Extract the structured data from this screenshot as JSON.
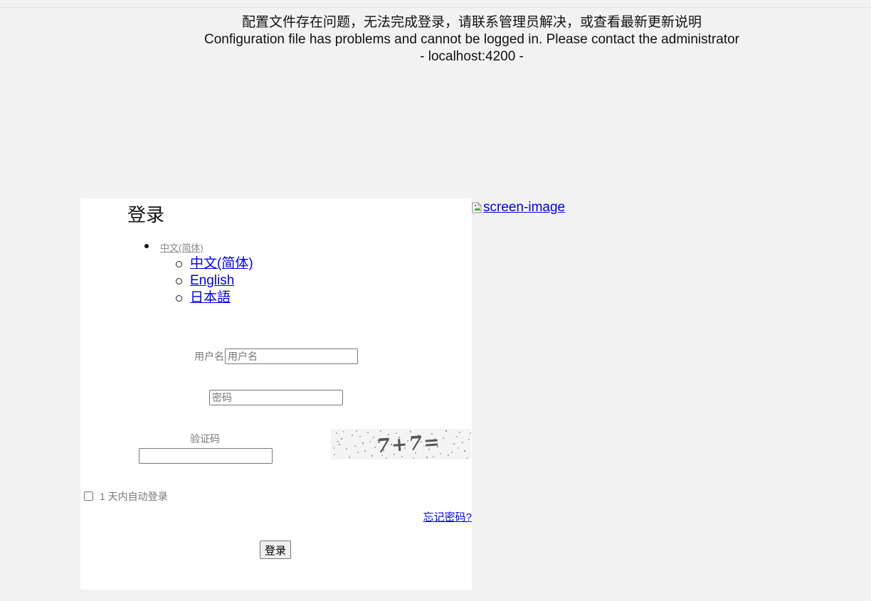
{
  "notice": {
    "line_zh": "配置文件存在问题，无法完成登录，请联系管理员解决，或查看最新更新说明",
    "line_en": "Configuration file has problems and cannot be logged in. Please contact the administrator",
    "host": "- localhost:4200 -"
  },
  "login": {
    "title": "登录",
    "language": {
      "current": "中文(简体)",
      "options": [
        "中文(简体)",
        "English",
        "日本語"
      ]
    },
    "username": {
      "label": "用户名",
      "placeholder": "用户名",
      "value": ""
    },
    "password": {
      "placeholder": "密码",
      "value": ""
    },
    "captcha": {
      "label": "验证码",
      "value": "",
      "image_text": "7+7="
    },
    "remember": {
      "label": "1 天内自动登录",
      "checked": false
    },
    "forgot_label": "忘记密码?",
    "submit_label": "登录"
  },
  "screen_image": {
    "alt": "screen-image",
    "icon": "broken-image-icon"
  },
  "colors": {
    "background": "#f2f2f2",
    "panel": "#ffffff",
    "link": "#0000ee",
    "muted_text": "#777777"
  }
}
